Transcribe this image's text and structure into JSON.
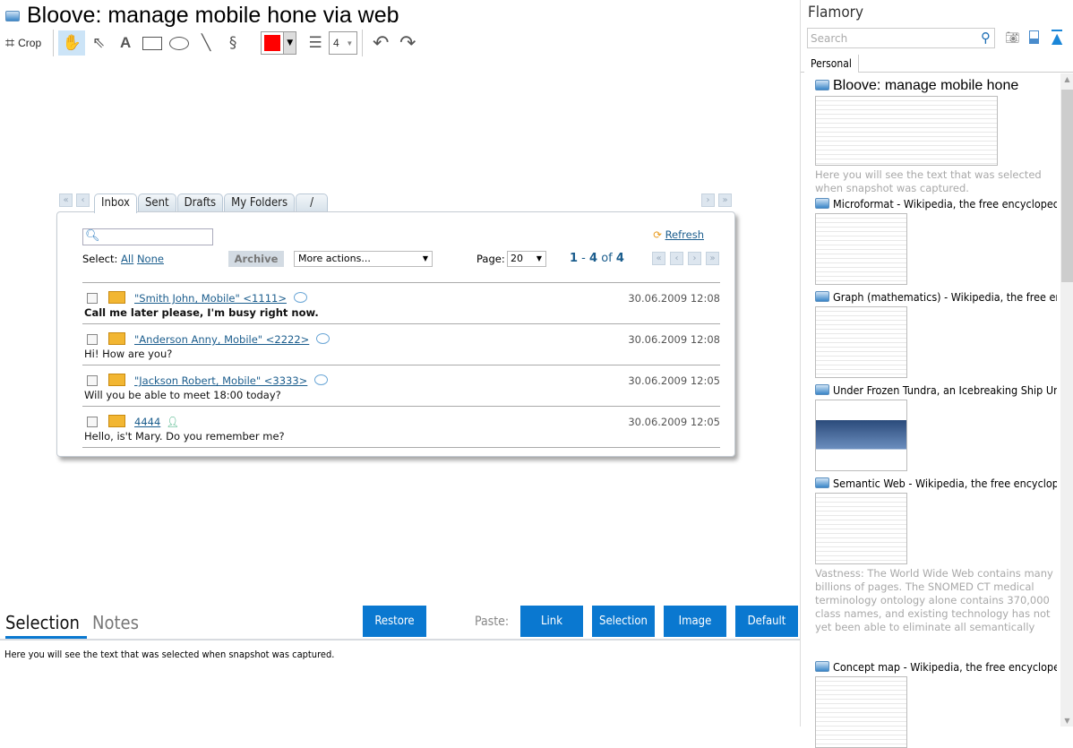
{
  "window": {
    "title": "Bloove: manage mobile hone via web",
    "icon": "app-icon"
  },
  "toolbar": {
    "crop_label": "Crop",
    "tools": [
      "hand-icon",
      "pointer-icon",
      "text-icon",
      "rectangle-icon",
      "ellipse-icon",
      "line-icon",
      "freehand-icon"
    ],
    "color": "#ff0000",
    "stroke_width": "4"
  },
  "email": {
    "tabs": [
      "Inbox",
      "Sent",
      "Drafts",
      "My Folders",
      "/"
    ],
    "refresh": "Refresh",
    "select_label": "Select:",
    "select_all": "All",
    "select_none": "None",
    "archive": "Archive",
    "more_actions": "More actions...",
    "page_label": "Page:",
    "page_size": "20",
    "range": {
      "from": "1",
      "to": "4",
      "of": "of",
      "total": "4"
    },
    "messages": [
      {
        "from": "\"Smith John, Mobile\" <1111>",
        "date": "30.06.2009 12:08",
        "text": "Call me later please, I'm busy right now.",
        "unread": true
      },
      {
        "from": "\"Anderson Anny, Mobile\" <2222>",
        "date": "30.06.2009 12:08",
        "text": "Hi! How are you?",
        "unread": false
      },
      {
        "from": "\"Jackson Robert, Mobile\" <3333>",
        "date": "30.06.2009 12:05",
        "text": "Will you be able to meet 18:00 today?",
        "unread": false
      },
      {
        "from": "4444",
        "date": "30.06.2009 12:05",
        "text": "Hello, is't Mary. Do you remember me?",
        "unread": false
      }
    ]
  },
  "bottom": {
    "tabs": [
      "Selection",
      "Notes"
    ],
    "restore": "Restore",
    "paste_label": "Paste:",
    "paste_buttons": [
      "Link",
      "Selection",
      "Image",
      "Default"
    ],
    "selection_text": "Here you will see the text that was selected when snapshot was captured."
  },
  "sidebar": {
    "title": "Flamory",
    "search_placeholder": "Search",
    "tab": "Personal",
    "items": [
      {
        "title": "Bloove: manage mobile hone",
        "desc": "Here you will see the text that was selected when snapshot was captured."
      },
      {
        "title": "Microformat - Wikipedia, the free encyclopedia",
        "desc": ""
      },
      {
        "title": "Graph (mathematics) - Wikipedia, the free encyclopedia",
        "desc": ""
      },
      {
        "title": "Under Frozen Tundra, an Icebreaking Ship Uncovers",
        "desc": ""
      },
      {
        "title": "Semantic Web - Wikipedia, the free encyclopedia",
        "desc": "Vastness: The World Wide Web contains many billions of pages. The SNOMED CT medical terminology ontology alone contains 370,000 class names, and existing technology has not yet been able to eliminate all semantically duplicated terms. Any automated reasoning system will have to deal with truly huge inputs."
      },
      {
        "title": "Concept map - Wikipedia, the free encyclopedia",
        "desc": ""
      }
    ]
  }
}
